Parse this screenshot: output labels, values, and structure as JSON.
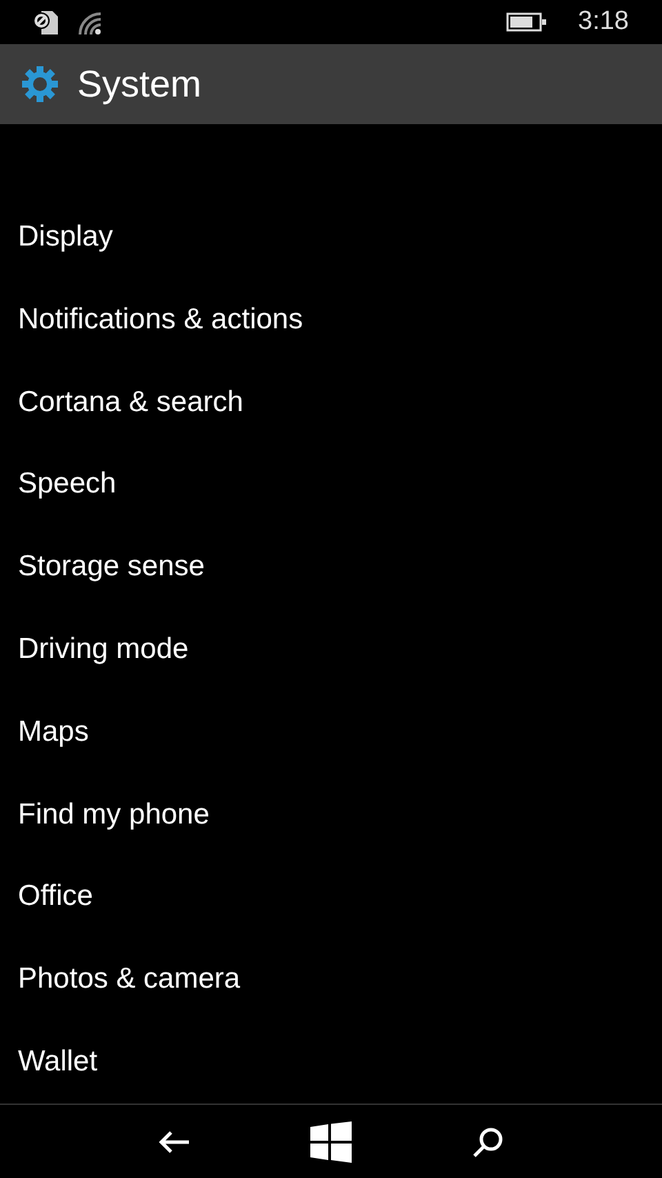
{
  "status_bar": {
    "time": "3:18"
  },
  "header": {
    "title": "System"
  },
  "items": [
    {
      "label": "Display"
    },
    {
      "label": "Notifications & actions"
    },
    {
      "label": "Cortana & search"
    },
    {
      "label": "Speech"
    },
    {
      "label": "Storage sense"
    },
    {
      "label": "Driving mode"
    },
    {
      "label": "Maps"
    },
    {
      "label": "Find my phone"
    },
    {
      "label": "Office"
    },
    {
      "label": "Photos & camera"
    },
    {
      "label": "Wallet"
    }
  ]
}
